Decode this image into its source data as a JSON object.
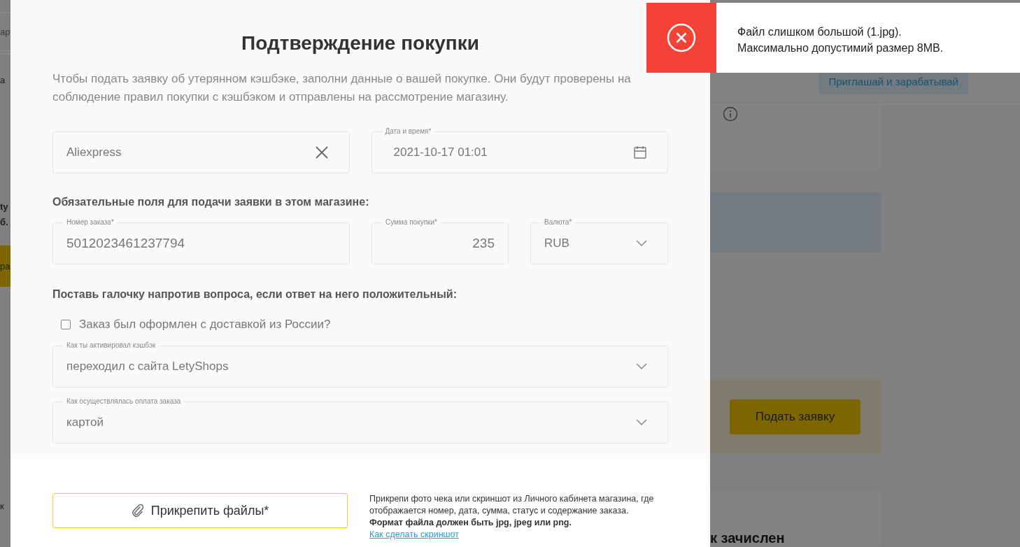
{
  "background_page": {
    "left_fragments": [
      {
        "kind": "field",
        "text": "ар"
      },
      {
        "kind": "plain",
        "text": "а"
      },
      {
        "kind": "bold",
        "text": "ty"
      },
      {
        "kind": "bold",
        "text": "б."
      },
      {
        "kind": "button",
        "text": "ра"
      },
      {
        "kind": "plain",
        "text": "к"
      }
    ],
    "invite_button": "Приглашай и зарабатывай",
    "submit_button": "Подать заявку",
    "bottom_card_title": "к зачислен"
  },
  "modal": {
    "title": "Подтверждение покупки",
    "intro": "Чтобы подать заявку об утерянном кэшбэке, заполни данные о вашей покупке. Они будут проверены на соблюдение правил покупки с кэшбэком и отправлены на рассмотрение магазину.",
    "store_field": {
      "value": "Aliexpress"
    },
    "date_field": {
      "label": "Дата и время*",
      "value": "2021-10-17 01:01"
    },
    "required_heading": "Обязательные поля для подачи заявки в этом магазине:",
    "order_field": {
      "label": "Номер заказа*",
      "value": "5012023461237794"
    },
    "sum_field": {
      "label": "Сумма покупки*",
      "value": "235"
    },
    "currency_field": {
      "label": "Валюта*",
      "value": "RUB"
    },
    "checkbox_heading": "Поставь галочку напротив вопроса, если ответ на него положительный:",
    "checkboxes": [
      {
        "label": "Заказ был оформлен с доставкой из России?",
        "checked": false
      }
    ],
    "selects": [
      {
        "label": "Как ты активировал кэшбэк",
        "value": "переходил с сайта LetyShops"
      },
      {
        "label": "Как осуществлялась оплата заказа",
        "value": "картой"
      }
    ],
    "attach_button": "Прикрепить файлы*",
    "attach_note": {
      "text": "Прикрепи фото чека или скриншот из Личного кабинета магазина, где отображается номер, дата, сумма, статус и содержание заказа.",
      "format_note": "Формат файла должен быть jpg, jpeg или png.",
      "link": "Как сделать скриншот"
    }
  },
  "toast": {
    "kind": "error",
    "message_lines": [
      "Файл слишком большой (1.jpg).",
      "Максимально допустимий размер 8MB."
    ]
  }
}
